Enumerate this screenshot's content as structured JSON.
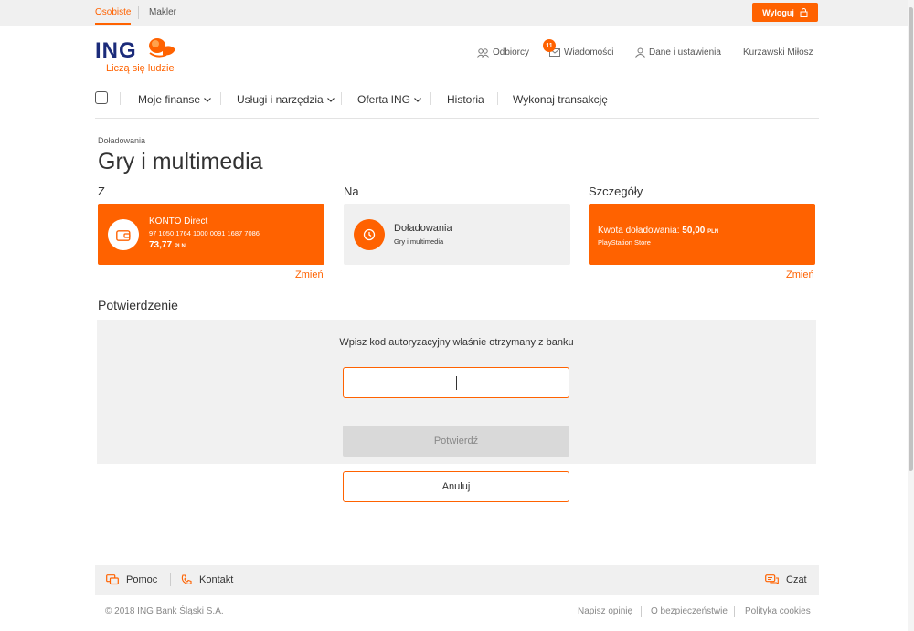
{
  "topbar": {
    "tabs": [
      {
        "label": "Osobiste",
        "active": true
      },
      {
        "label": "Makler",
        "active": false
      }
    ],
    "logout_label": "Wyloguj"
  },
  "logo": {
    "brand": "ING",
    "tagline": "Liczą się ludzie"
  },
  "user_nav": {
    "recipients": "Odbiorcy",
    "messages": "Wiadomości",
    "messages_count": "11",
    "settings": "Dane i ustawienia",
    "user_name": "Kurzawski Miłosz"
  },
  "main_nav": {
    "items": [
      {
        "label": "Moje finanse",
        "dropdown": true
      },
      {
        "label": "Usługi i narzędzia",
        "dropdown": true
      },
      {
        "label": "Oferta ING",
        "dropdown": true
      },
      {
        "label": "Historia",
        "dropdown": false
      },
      {
        "label": "Wykonaj transakcję",
        "dropdown": false
      }
    ]
  },
  "breadcrumb": "Doładowania",
  "page_title": "Gry i multimedia",
  "from": {
    "label": "Z",
    "account_name": "KONTO Direct",
    "account_number": "97 1050 1764 1000 0091 1687 7086",
    "balance": "73,77",
    "currency": "PLN",
    "change_label": "Zmień"
  },
  "to": {
    "label": "Na",
    "title": "Doładowania",
    "subtitle": "Gry i multimedia"
  },
  "details": {
    "label": "Szczegóły",
    "amount_label": "Kwota doładowania:",
    "amount": "50,00",
    "currency": "PLN",
    "store": "PlayStation Store",
    "change_label": "Zmień"
  },
  "confirmation": {
    "title": "Potwierdzenie",
    "prompt": "Wpisz kod autoryzacyjny właśnie otrzymany z banku",
    "code_value": "",
    "confirm_label": "Potwierdź",
    "cancel_label": "Anuluj"
  },
  "footer": {
    "help": "Pomoc",
    "contact": "Kontakt",
    "chat": "Czat",
    "copyright": "© 2018 ING Bank Śląski S.A.",
    "links": [
      "Napisz opinię",
      "O bezpieczeństwie",
      "Polityka cookies"
    ]
  },
  "colors": {
    "accent": "#ff6200",
    "brand_navy": "#1b2b7a",
    "panel_grey": "#f0f0f0"
  }
}
